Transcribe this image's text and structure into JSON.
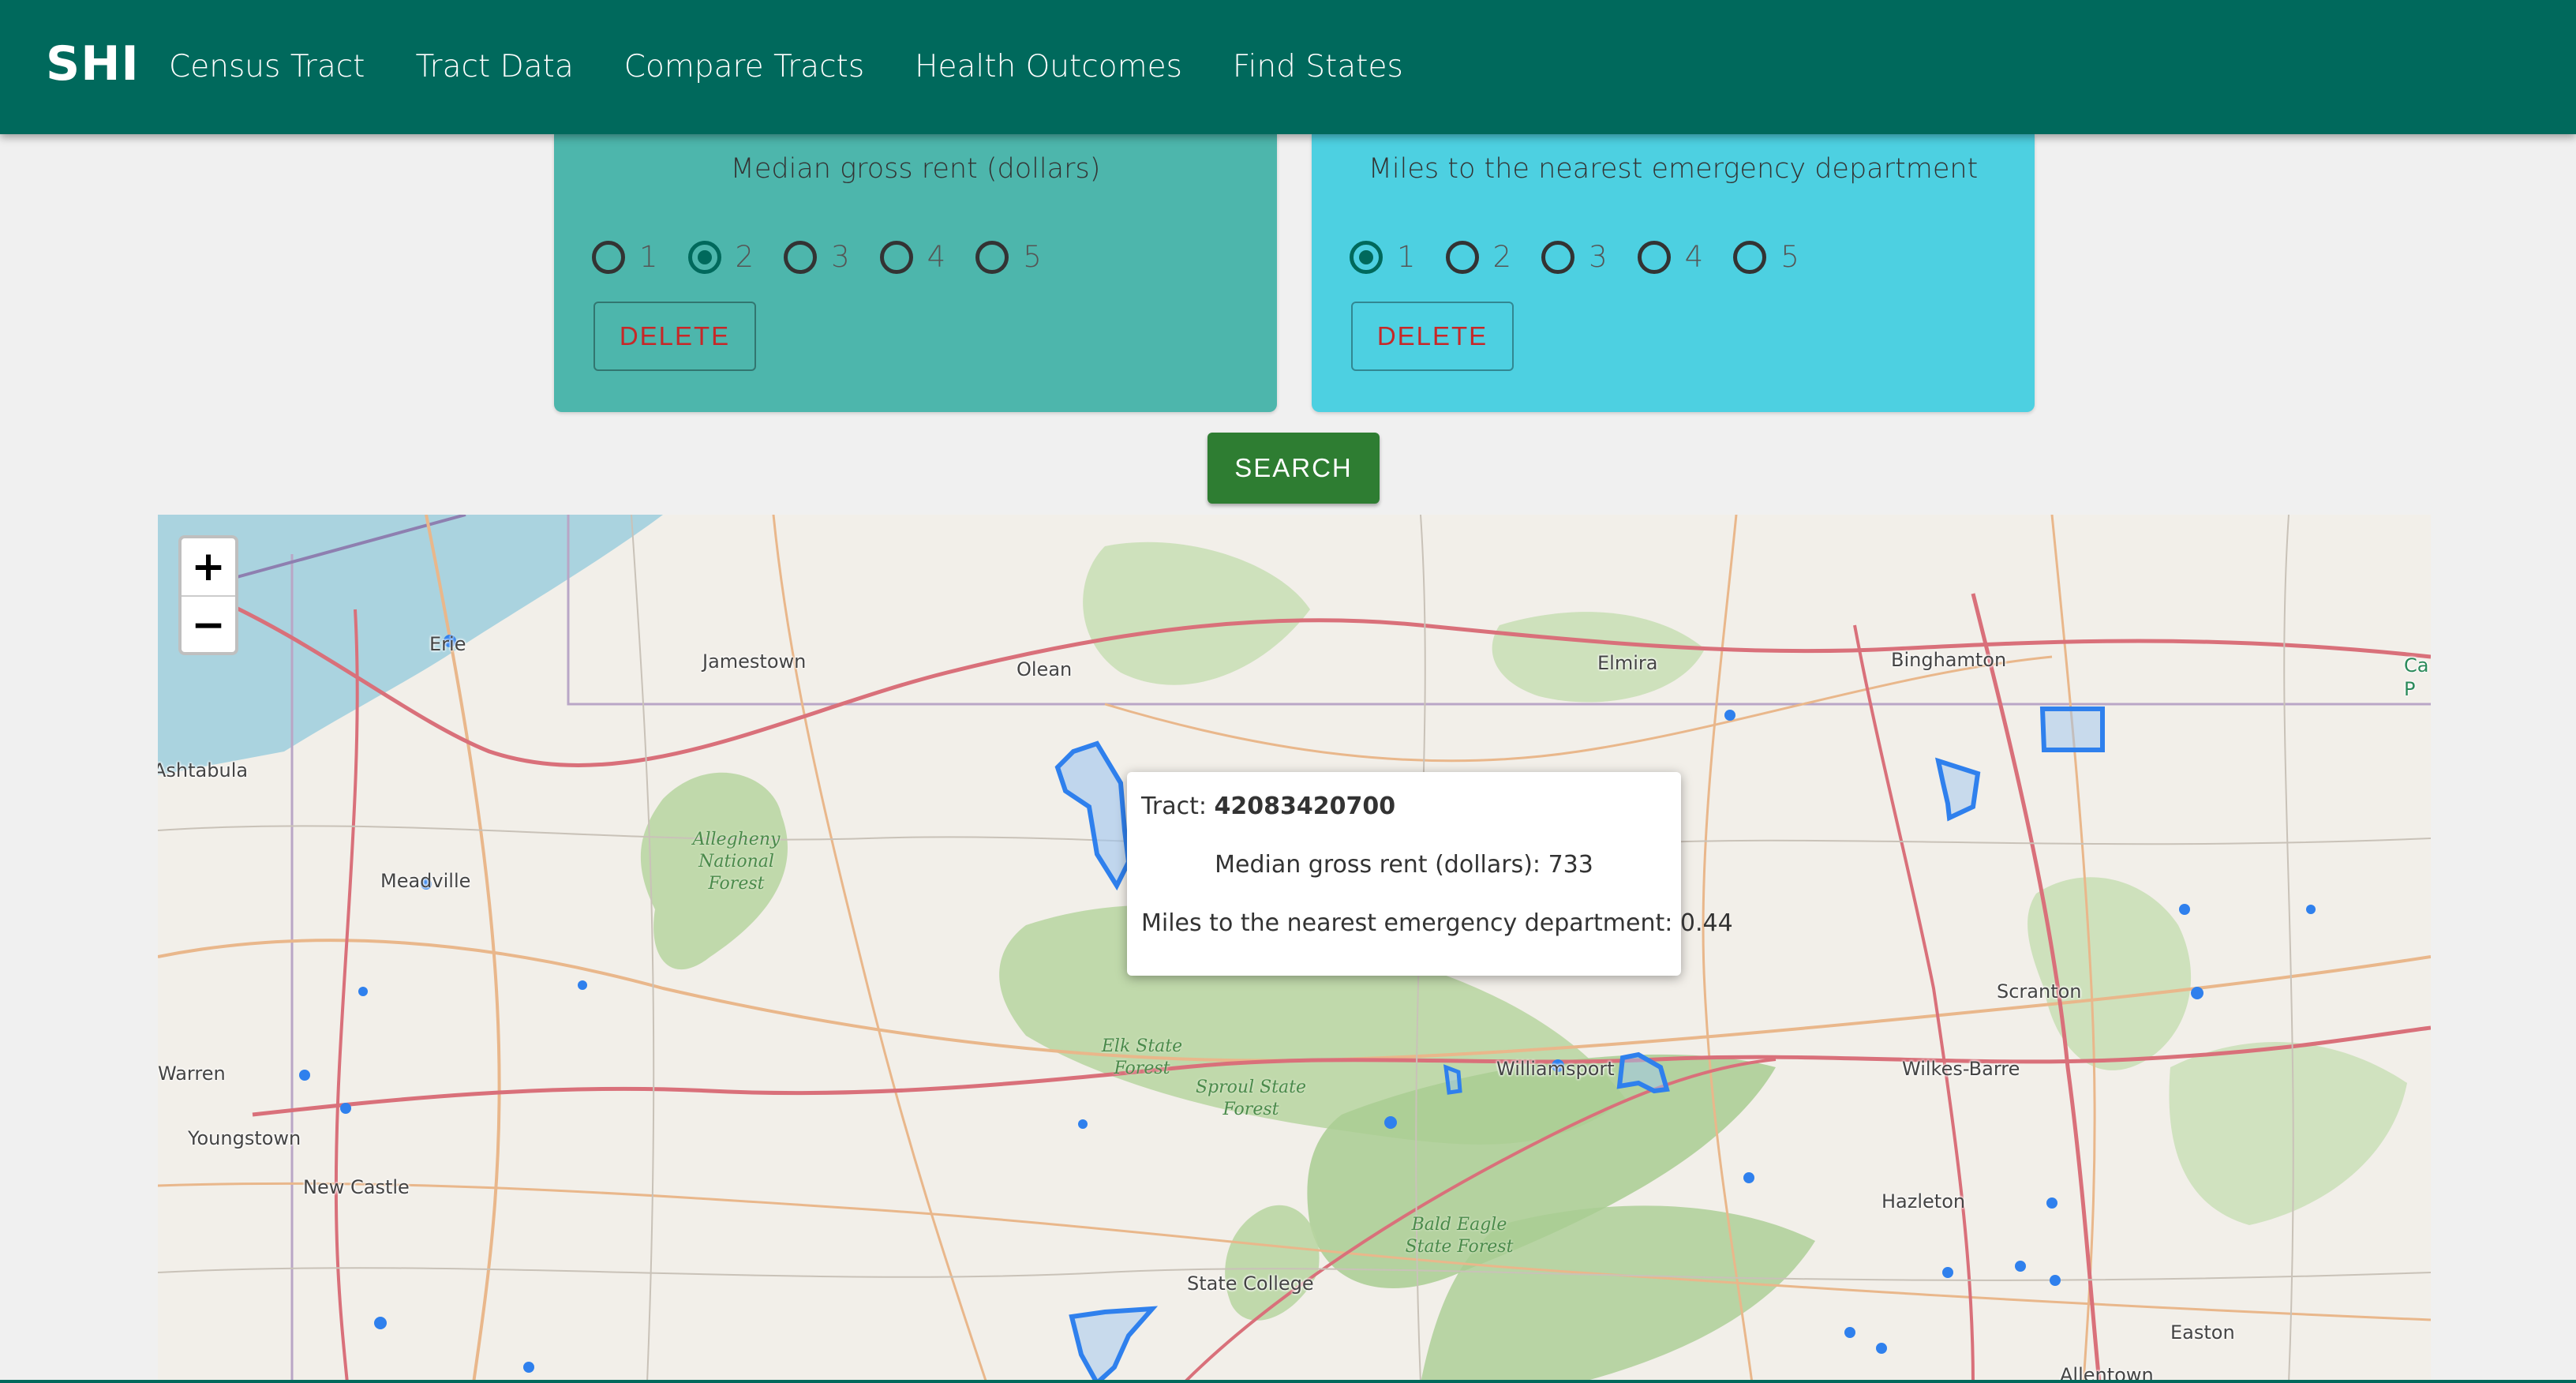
{
  "app": {
    "brand": "SHI",
    "nav": [
      "Census Tract",
      "Tract Data",
      "Compare Tracts",
      "Health Outcomes",
      "Find States"
    ]
  },
  "filters": [
    {
      "title": "Median gross rent (dollars)",
      "options": [
        "1",
        "2",
        "3",
        "4",
        "5"
      ],
      "selected": "2",
      "delete_label": "DELETE",
      "color": "#4db6ac"
    },
    {
      "title": "Miles to the nearest emergency department",
      "options": [
        "1",
        "2",
        "3",
        "4",
        "5"
      ],
      "selected": "1",
      "delete_label": "DELETE",
      "color": "#4dd0e1"
    }
  ],
  "search_label": "SEARCH",
  "map": {
    "zoom_in": "+",
    "zoom_out": "−",
    "places": [
      "Erie",
      "Jamestown",
      "Olean",
      "Elmira",
      "Binghamton",
      "Ashtabula",
      "Meadville",
      "Warren",
      "Youngstown",
      "New Castle",
      "Williamsport",
      "Scranton",
      "Wilkes-Barre",
      "Hazleton",
      "State College",
      "Easton",
      "Allentown",
      "Ca P"
    ],
    "forests": [
      "Allegheny National Forest",
      "Elk State Forest",
      "Sproul State Forest",
      "Bald Eagle State Forest"
    ],
    "tooltip": {
      "tract_label": "Tract:",
      "tract_id": "42083420700",
      "rent_line": "Median gross rent (dollars): 733",
      "miles_line": "Miles to the nearest emergency department: 0.44"
    },
    "colors": {
      "tract_fill": "#9ec5f0",
      "tract_stroke": "#2f80ed",
      "forest": "#b7d5a0",
      "water": "#aad3df"
    }
  }
}
